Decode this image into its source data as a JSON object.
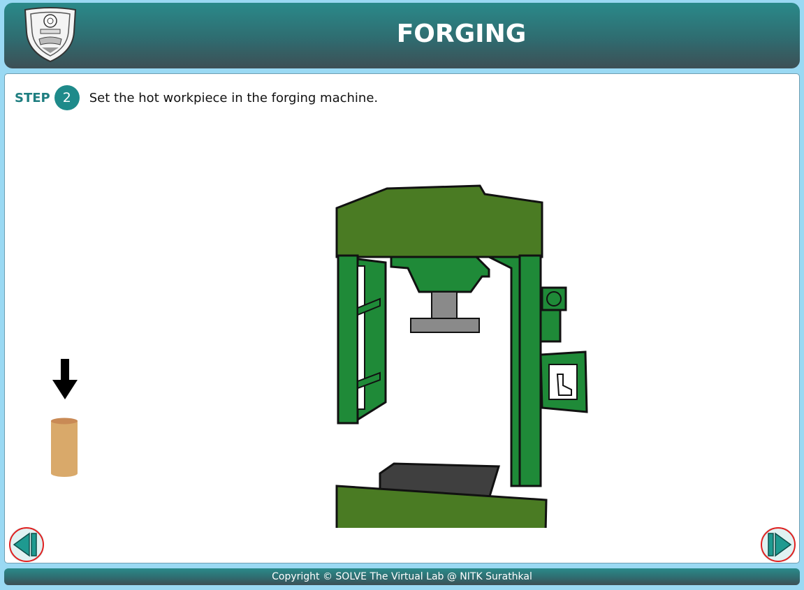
{
  "header": {
    "title": "FORGING",
    "logo_icon": "nitk-crest-logo"
  },
  "step": {
    "label": "STEP",
    "number": "2",
    "instruction": "Set the hot workpiece in the forging machine."
  },
  "scene": {
    "arrow_icon": "arrow-down-icon",
    "workpiece_color": "#d9a96a",
    "machine_color": "#1f8a38",
    "machine_top_color": "#4d7a24"
  },
  "navigation": {
    "prev_icon": "previous-icon",
    "next_icon": "next-icon",
    "accent": "#1e8a8a",
    "ring": "#e02020"
  },
  "footer": {
    "copyright": "Copyright © SOLVE The Virtual Lab @ NITK Surathkal"
  }
}
